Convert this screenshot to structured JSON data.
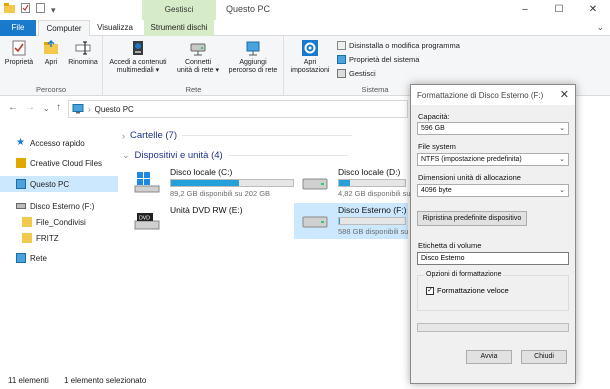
{
  "window": {
    "title": "Questo PC",
    "contextual_tab_group": "Gestisci",
    "controls": [
      "–",
      "☐",
      "✕"
    ]
  },
  "tabs": {
    "file": "File",
    "computer": "Computer",
    "visualizza": "Visualizza",
    "strumenti_dischi": "Strumenti dischi"
  },
  "ribbon": {
    "groups": {
      "percorso": "Percorso",
      "rete": "Rete",
      "sistema": "Sistema"
    },
    "buttons": {
      "proprieta": "Proprietà",
      "apri": "Apri",
      "rinomina": "Rinomina",
      "accedi_line1": "Accedi a contenuti",
      "accedi_line2": "multimediali ▾",
      "connetti_line1": "Connetti",
      "connetti_line2": "unità di rete ▾",
      "aggiungi_line1": "Aggiungi",
      "aggiungi_line2": "percorso di rete",
      "apri_imp_line1": "Apri",
      "apri_imp_line2": "impostazioni",
      "disinstalla": "Disinstalla o modifica programma",
      "proprieta_sistema": "Proprietà del sistema",
      "gestisci": "Gestisci"
    }
  },
  "address": {
    "path": "Questo PC"
  },
  "navpane": {
    "items": [
      {
        "label": "Accesso rapido"
      },
      {
        "label": "Creative Cloud Files"
      },
      {
        "label": "Questo PC"
      },
      {
        "label": "Disco Esterno (F:)"
      },
      {
        "label": "File_Condivisi"
      },
      {
        "label": "FRITZ"
      },
      {
        "label": "Rete"
      }
    ]
  },
  "content": {
    "folders_header": "Cartelle (7)",
    "devices_header": "Dispositivi e unità (4)",
    "drives": [
      {
        "name": "Disco locale (C:)",
        "info": "89,2 GB disponibili su 202 GB",
        "used_fraction": 0.56
      },
      {
        "name": "Disco locale (D:)",
        "info": "4,82 GB disponibili su 5,75 GB",
        "used_fraction": 0.16
      },
      {
        "name": "Unità DVD RW (E:)",
        "info": "",
        "used_fraction": null
      },
      {
        "name": "Disco Esterno (F:)",
        "info": "588 GB disponibili su 596 GB",
        "used_fraction": 0.02
      }
    ]
  },
  "statusbar": {
    "count": "11 elementi",
    "selected": "1 elemento selezionato"
  },
  "dialog": {
    "title": "Formattazione di Disco Esterno (F:)",
    "capacity_label": "Capacità:",
    "capacity_value": "596 GB",
    "filesystem_label": "File system",
    "filesystem_value": "NTFS (impostazione predefinita)",
    "allocation_label": "Dimensioni unità di allocazione",
    "allocation_value": "4096 byte",
    "restore_button": "Ripristina predefinite dispositivo",
    "volume_label": "Etichetta di volume",
    "volume_value": "Disco Esterno",
    "options_legend": "Opzioni di formattazione",
    "quick_format": "Formattazione veloce",
    "quick_format_checked": true,
    "start_button": "Avvia",
    "close_button": "Chiudi"
  },
  "colors": {
    "accent": "#1979ca",
    "selection": "#cce8ff",
    "contextual": "#d6ecc9",
    "drive_bar": "#26a0da",
    "section_heading": "#1e3287"
  }
}
